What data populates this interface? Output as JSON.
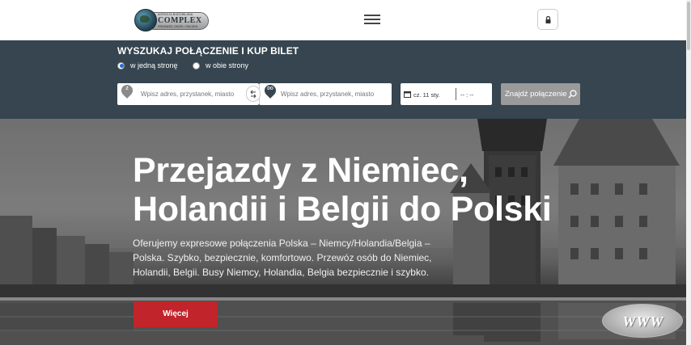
{
  "header": {
    "logo": {
      "top_text": "AGENCJA BUDOWLANA",
      "name": "COMPLEX",
      "sub_text": "PRZEWÓZ OSÓB / PACZEK"
    },
    "menu_icon": "hamburger-menu-icon",
    "account_icon": "lock-icon"
  },
  "search": {
    "title": "WYSZUKAJ POŁĄCZENIE I KUP BILET",
    "trip_types": [
      {
        "label": "w jedną stronę",
        "selected": true
      },
      {
        "label": "w obie strony",
        "selected": false
      }
    ],
    "from": {
      "badge": "Z",
      "placeholder": "Wpisz adres, przystanek, miasto"
    },
    "to": {
      "badge": "DO",
      "placeholder": "Wpisz adres, przystanek, miasto"
    },
    "date": "cz. 11 sty.",
    "time": "-- : --",
    "find_button": "Znajdź połączenie",
    "colors": {
      "panel": "#36454f",
      "from_pin": "#8a8a8a",
      "to_pin": "#36454f"
    }
  },
  "hero": {
    "title_line1": "Przejazdy z Niemiec,",
    "title_line2": "Holandii i Belgii do Polski",
    "description": "Oferujemy expresowe połączenia Polska – Niemcy/Holandia/Belgia – Polska. Szybko, bezpiecznie, komfortowo. Przewóz osób do Niemiec, Holandii, Belgii. Busy Niemcy, Holandia, Belgia bezpiecznie i szybko.",
    "more_button": "Więcej",
    "badge": "WWW",
    "colors": {
      "button": "#c1242a"
    }
  }
}
